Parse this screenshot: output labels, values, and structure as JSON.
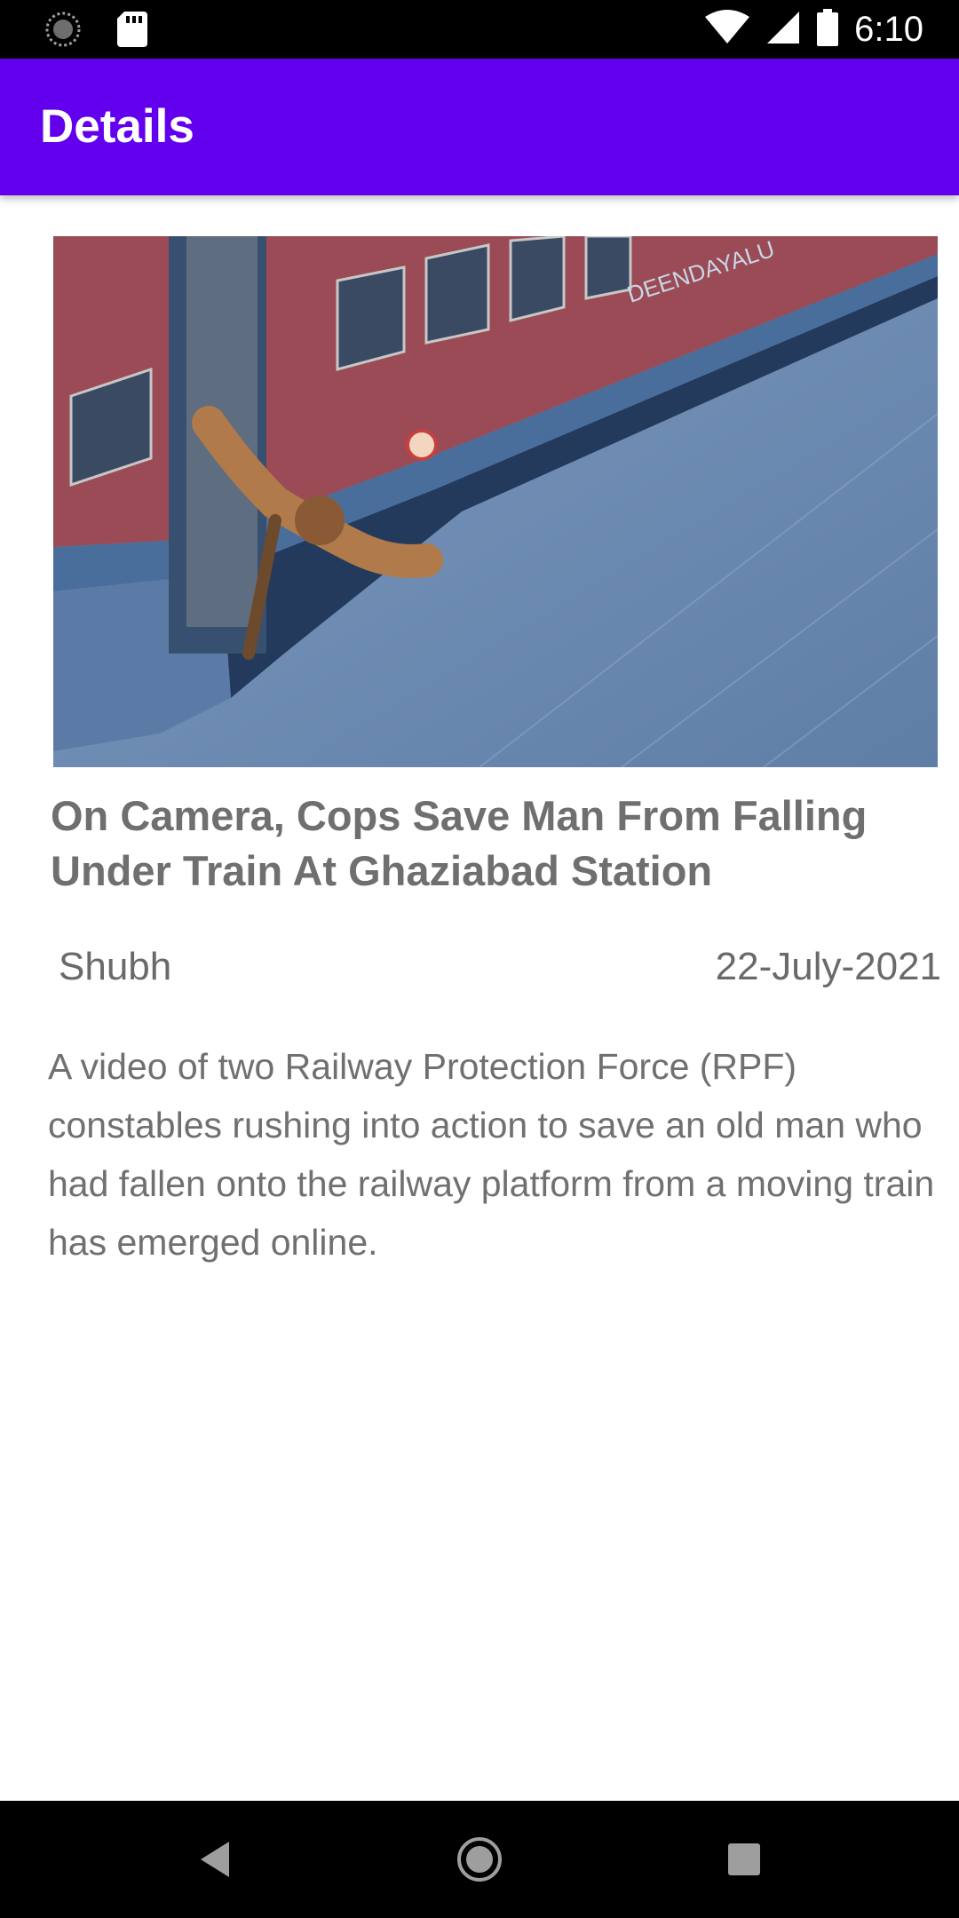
{
  "status_bar": {
    "time": "6:10",
    "icons": [
      "loading-icon",
      "sd-card-icon",
      "wifi-icon",
      "cell-signal-icon",
      "battery-icon"
    ]
  },
  "app_bar": {
    "title": "Details",
    "color": "#6200ee"
  },
  "article": {
    "headline": "On Camera, Cops Save Man From Falling Under Train At Ghaziabad Station",
    "author": "Shubh",
    "date": "22-July-2021",
    "body": "A video of two Railway Protection Force (RPF) constables rushing into action to save an old man who had fallen onto the railway platform from a moving train has emerged online.",
    "image_icon": "train-platform-photo"
  },
  "nav_bar": {
    "icons": [
      "back-icon",
      "home-icon",
      "recents-icon"
    ]
  }
}
